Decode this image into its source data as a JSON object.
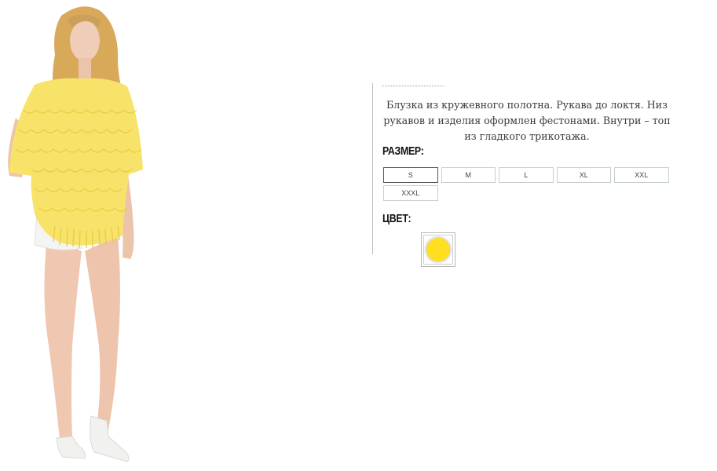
{
  "product": {
    "description": "Блузка из кружевного полотна. Рукава до локтя. Низ рукавов и изделия оформлен фестонами. Внутри – топ из гладкого трикотажа.",
    "size_label": "РАЗМЕР:",
    "sizes": [
      "S",
      "M",
      "L",
      "XL",
      "XXL",
      "XXXL"
    ],
    "selected_size": "S",
    "color_label": "ЦВЕТ:",
    "colors": [
      {
        "name": "yellow",
        "hex": "#ffdf1f"
      }
    ]
  },
  "image": {
    "subject": "model wearing yellow lace blouse and white shorts",
    "blouse_color": "#f7e36a",
    "shorts_color": "#f4f4f2",
    "shoes_color": "#f1f1ef"
  }
}
